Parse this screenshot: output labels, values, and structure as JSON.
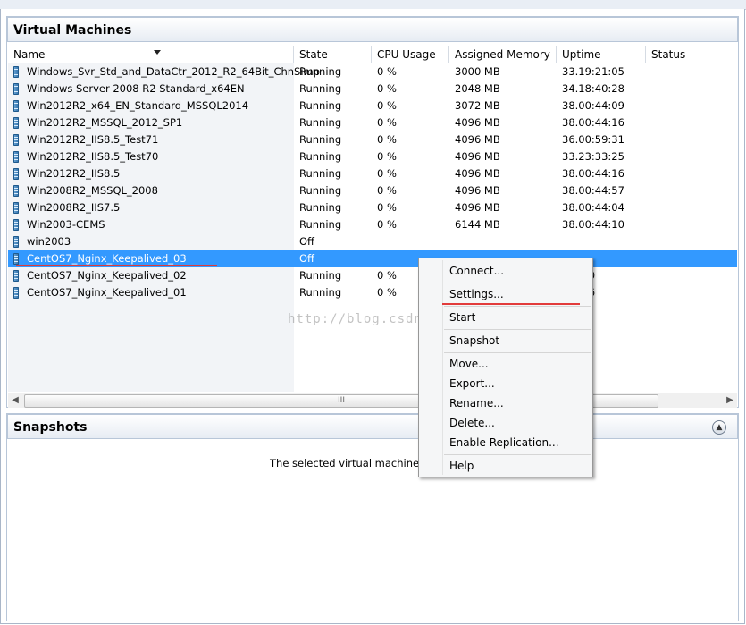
{
  "vm_section": {
    "title": "Virtual Machines",
    "columns": [
      "Name",
      "State",
      "CPU Usage",
      "Assigned Memory",
      "Uptime",
      "Status"
    ],
    "rows": [
      {
        "name": "Windows_Svr_Std_and_DataCtr_2012_R2_64Bit_ChnSimp",
        "state": "Running",
        "cpu": "0 %",
        "memory": "3000 MB",
        "uptime": "33.19:21:05",
        "status": ""
      },
      {
        "name": "Windows Server 2008 R2 Standard_x64EN",
        "state": "Running",
        "cpu": "0 %",
        "memory": "2048 MB",
        "uptime": "34.18:40:28",
        "status": ""
      },
      {
        "name": "Win2012R2_x64_EN_Standard_MSSQL2014",
        "state": "Running",
        "cpu": "0 %",
        "memory": "3072 MB",
        "uptime": "38.00:44:09",
        "status": ""
      },
      {
        "name": "Win2012R2_MSSQL_2012_SP1",
        "state": "Running",
        "cpu": "0 %",
        "memory": "4096 MB",
        "uptime": "38.00:44:16",
        "status": ""
      },
      {
        "name": "Win2012R2_IIS8.5_Test71",
        "state": "Running",
        "cpu": "0 %",
        "memory": "4096 MB",
        "uptime": "36.00:59:31",
        "status": ""
      },
      {
        "name": "Win2012R2_IIS8.5_Test70",
        "state": "Running",
        "cpu": "0 %",
        "memory": "4096 MB",
        "uptime": "33.23:33:25",
        "status": ""
      },
      {
        "name": "Win2012R2_IIS8.5",
        "state": "Running",
        "cpu": "0 %",
        "memory": "4096 MB",
        "uptime": "38.00:44:16",
        "status": ""
      },
      {
        "name": "Win2008R2_MSSQL_2008",
        "state": "Running",
        "cpu": "0 %",
        "memory": "4096 MB",
        "uptime": "38.00:44:57",
        "status": ""
      },
      {
        "name": "Win2008R2_IIS7.5",
        "state": "Running",
        "cpu": "0 %",
        "memory": "4096 MB",
        "uptime": "38.00:44:04",
        "status": ""
      },
      {
        "name": "Win2003-CEMS",
        "state": "Running",
        "cpu": "0 %",
        "memory": "6144 MB",
        "uptime": "38.00:44:10",
        "status": ""
      },
      {
        "name": "win2003",
        "state": "Off",
        "cpu": "",
        "memory": "",
        "uptime": "",
        "status": ""
      },
      {
        "name": "CentOS7_Nginx_Keepalived_03",
        "state": "Off",
        "cpu": "",
        "memory": "",
        "uptime": "",
        "status": "",
        "selected": true
      },
      {
        "name": "CentOS7_Nginx_Keepalived_02",
        "state": "Running",
        "cpu": "0 %",
        "memory": "",
        "uptime": ":44:20",
        "status": ""
      },
      {
        "name": "CentOS7_Nginx_Keepalived_01",
        "state": "Running",
        "cpu": "0 %",
        "memory": "",
        "uptime": ":44:16",
        "status": ""
      }
    ],
    "scroll_thumb_glyph": "III"
  },
  "snapshots_section": {
    "title": "Snapshots",
    "message": "The selected virtual machine has no"
  },
  "context_menu": {
    "items": [
      "Connect...",
      "Settings...",
      "Start",
      "Snapshot",
      "Move...",
      "Export...",
      "Rename...",
      "Delete...",
      "Enable Replication...",
      "Help"
    ]
  },
  "watermark": "http://blog.csdn.net/",
  "colors": {
    "selection": "#3399ff",
    "annotation_red": "#e23b3b",
    "header_border": "#b8c6d8"
  },
  "icons": {
    "vm": "server-vm-icon",
    "collapse": "chevron-up-circle-icon",
    "scroll_left": "arrow-left-icon",
    "scroll_right": "arrow-right-icon"
  }
}
